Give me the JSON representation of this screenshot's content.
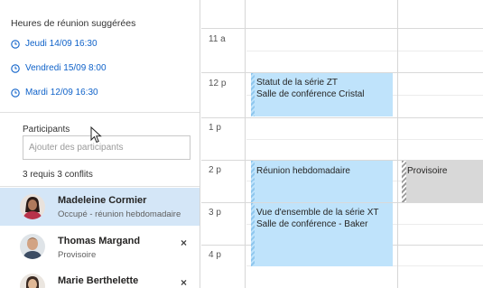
{
  "suggestions": {
    "title": "Heures de réunion suggérées",
    "items": [
      {
        "label": "Jeudi 14/09 16:30"
      },
      {
        "label": "Vendredi 15/09 8:00"
      },
      {
        "label": "Mardi 12/09 16:30"
      }
    ]
  },
  "participants": {
    "title": "Participants",
    "placeholder": "Ajouter des participants",
    "count_text": "3 requis 3 conflits",
    "people": [
      {
        "name": "Madeleine Cormier",
        "status": "Occupé - réunion hebdomadaire"
      },
      {
        "name": "Thomas Margand",
        "status": "Provisoire",
        "remove": "×"
      },
      {
        "name": "Marie Berthelette",
        "remove": "×"
      }
    ]
  },
  "calendar": {
    "times": [
      "11 a",
      "12 p",
      "1 p",
      "2 p",
      "3 p",
      "4 p"
    ],
    "events": [
      {
        "line1": "Statut de la série ZT",
        "line2": "Salle de conférence Cristal"
      },
      {
        "line1": "Réunion hebdomadaire"
      },
      {
        "line1": "Provisoire"
      },
      {
        "line1": "Vue d'ensemble de la série XT",
        "line2": "Salle de conférence - Baker"
      }
    ]
  },
  "colors": {
    "accent": "#0f62c9",
    "selected_row": "#d4e6f7",
    "event_busy": "#bfe3fb",
    "event_tentative": "#d8d8d8"
  },
  "icons": {
    "suggestion": "clock-icon",
    "remove": "close-icon",
    "pointer": "mouse-cursor"
  }
}
